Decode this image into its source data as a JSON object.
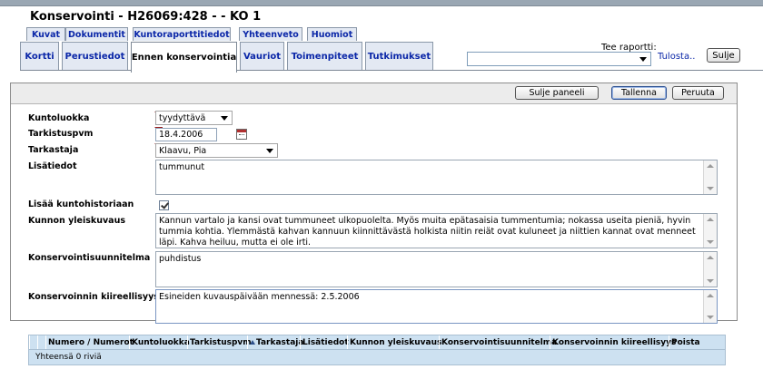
{
  "header": {
    "title": "Konservointi   - H26069:428 - - KO 1"
  },
  "tabs_row1": [
    {
      "label": "Kuvat"
    },
    {
      "label": "Dokumentit"
    },
    {
      "label": "Kuntoraporttitiedot"
    },
    {
      "label": "Yhteenveto"
    },
    {
      "label": "Huomiot"
    }
  ],
  "tabs_row2": [
    {
      "label": "Kortti"
    },
    {
      "label": "Perustiedot"
    },
    {
      "label": "Ennen konservointia"
    },
    {
      "label": "Vauriot"
    },
    {
      "label": "Toimenpiteet"
    },
    {
      "label": "Tutkimukset"
    }
  ],
  "report": {
    "label": "Tee raportti:",
    "selected": "",
    "print_link": "Tulosta..",
    "close_button": "Sulje"
  },
  "panel": {
    "buttons": {
      "close_panel": "Sulje paneeli",
      "save": "Tallenna",
      "cancel": "Peruuta"
    },
    "fields": {
      "kuntoluokka": {
        "label": "Kuntoluokka",
        "value": "tyydyttävä"
      },
      "tarkistuspvm": {
        "label": "Tarkistuspvm",
        "value": "18.4.2006"
      },
      "tarkastaja": {
        "label": "Tarkastaja",
        "value": "Klaavu, Pia"
      },
      "lisatiedot": {
        "label": "Lisätiedot",
        "value": "tummunut"
      },
      "lisaa_kuntohistoriaan": {
        "label": "Lisää kuntohistoriaan",
        "checked": true
      },
      "kunnon_yleiskuvaus": {
        "label": "Kunnon yleiskuvaus",
        "value": "Kannun vartalo ja kansi ovat tummuneet ulkopuolelta. Myös muita epätasaisia tummentumia; nokassa useita pieniä, hyvin tummia kohtia. Ylemmästä kahvan kannuun kiinnittävästä holkista niitin reiät ovat kuluneet ja niittien kannat ovat menneet läpi. Kahva heiluu, mutta ei ole irti."
      },
      "konservointisuunnitelma": {
        "label": "Konservointisuunnitelma",
        "value": "puhdistus"
      },
      "konservoinnin_kiireellisyys": {
        "label": "Konservoinnin kiireellisyys",
        "value": "Esineiden kuvauspäivään mennessä: 2.5.2006"
      }
    }
  },
  "grid": {
    "columns": [
      {
        "label": "Numero / Numerot"
      },
      {
        "label": "Kuntoluokka"
      },
      {
        "label": "Tarkistuspvm"
      },
      {
        "label": "Tarkastaja"
      },
      {
        "label": "Lisätiedot"
      },
      {
        "label": "Kunnon yleiskuvaus"
      },
      {
        "label": "Konservointisuunnitelma"
      },
      {
        "label": "Konservoinnin kiireellisyys"
      },
      {
        "label": "Poista"
      }
    ],
    "footer": "Yhteensä 0 riviä"
  }
}
